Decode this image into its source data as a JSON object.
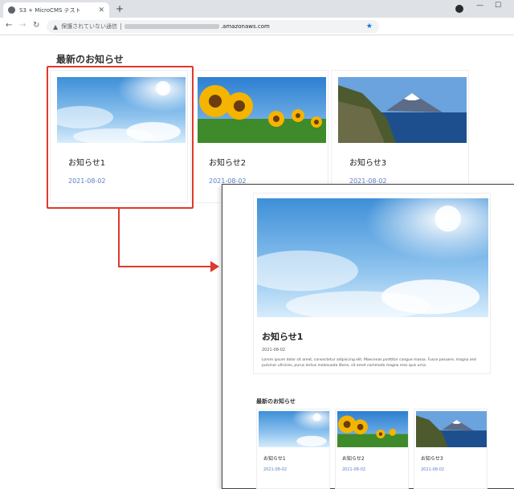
{
  "browser": {
    "tab_title": "S3 + MicroCMS テスト",
    "security_text": "保護されていない通信",
    "url_host": ".amazonaws.com"
  },
  "page": {
    "heading": "最新のお知らせ",
    "cards": [
      {
        "title": "お知らせ1",
        "date": "2021-08-02",
        "image": "sky-clouds"
      },
      {
        "title": "お知らせ2",
        "date": "2021-08-02",
        "image": "sunflowers"
      },
      {
        "title": "お知らせ3",
        "date": "2021-08-02",
        "image": "mount-fuji-coast"
      }
    ]
  },
  "detail": {
    "title": "お知らせ1",
    "date": "2021-08-02",
    "body": "Lorem ipsum dolor sit amet, consectetur adipiscing elit. Maecenas porttitor congue massa. Fusce posuere, magna sed pulvinar ultricies, purus lectus malesuada libero, sit amet commodo magna eros quis urna.",
    "heading": "最新のお知らせ",
    "cards": [
      {
        "title": "お知らせ1",
        "date": "2021-08-02"
      },
      {
        "title": "お知らせ2",
        "date": "2021-08-02"
      },
      {
        "title": "お知らせ3",
        "date": "2021-08-02"
      }
    ]
  },
  "colors": {
    "highlight": "#e0382c",
    "date_link": "#5b7fc7",
    "accent": "#1a73e8"
  }
}
